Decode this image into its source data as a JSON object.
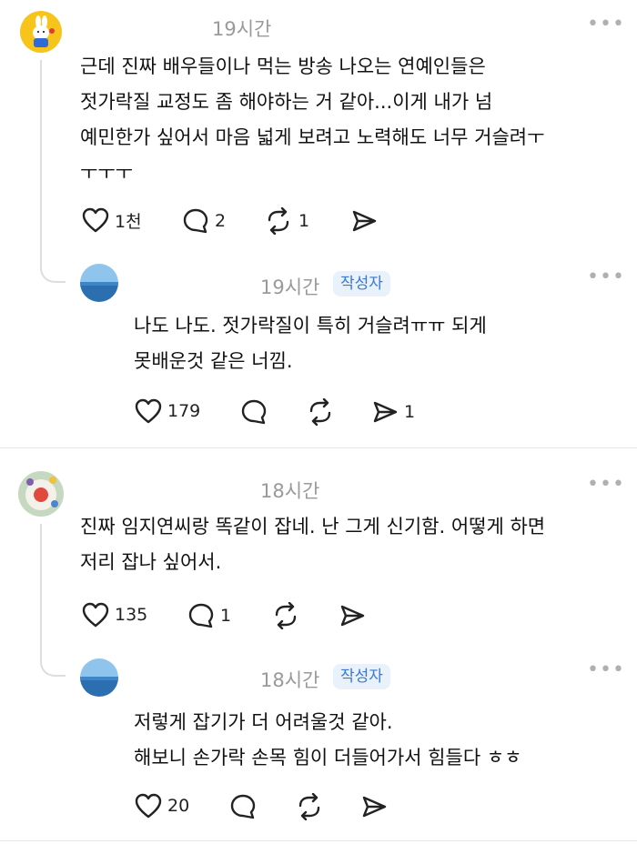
{
  "threads": [
    {
      "comment": {
        "time": "19시간",
        "text": "근데 진짜 배우들이나 먹는 방송 나오는 연예인들은\n젓가락질 교정도 좀 해야하는 거 같아...이게 내가 넘\n예민한가 싶어서 마음 넓게 보려고 노력해도 너무 거슬려ㅜ\nㅜㅜㅜ",
        "likes": "1천",
        "comments": "2",
        "reposts": "1",
        "shares": ""
      },
      "reply": {
        "time": "19시간",
        "badge": "작성자",
        "text": "나도 나도. 젓가락질이 특히 거슬려ㅠㅠ 되게\n못배운것 같은 너낌.",
        "likes": "179",
        "comments": "",
        "reposts": "",
        "shares": "1"
      }
    },
    {
      "comment": {
        "time": "18시간",
        "text": "진짜 임지연씨랑 똑같이 잡네. 난 그게 신기함. 어떻게 하면\n저리 잡나 싶어서.",
        "likes": "135",
        "comments": "1",
        "reposts": "",
        "shares": ""
      },
      "reply": {
        "time": "18시간",
        "badge": "작성자",
        "text": "저렇게 잡기가 더 어려울것 같아.\n해보니 손가락 손목 힘이 더들어가서 힘들다 ㅎㅎ",
        "likes": "20",
        "comments": "",
        "reposts": "",
        "shares": ""
      }
    }
  ],
  "more_label": "•••",
  "icons": [
    "heart-icon",
    "comment-icon",
    "repost-icon",
    "share-icon"
  ],
  "colors": {
    "badge_text": "#3a78d4",
    "badge_bg": "#e9f1fb",
    "time": "#9a9a9a",
    "avatar1": "#f7c41b"
  }
}
